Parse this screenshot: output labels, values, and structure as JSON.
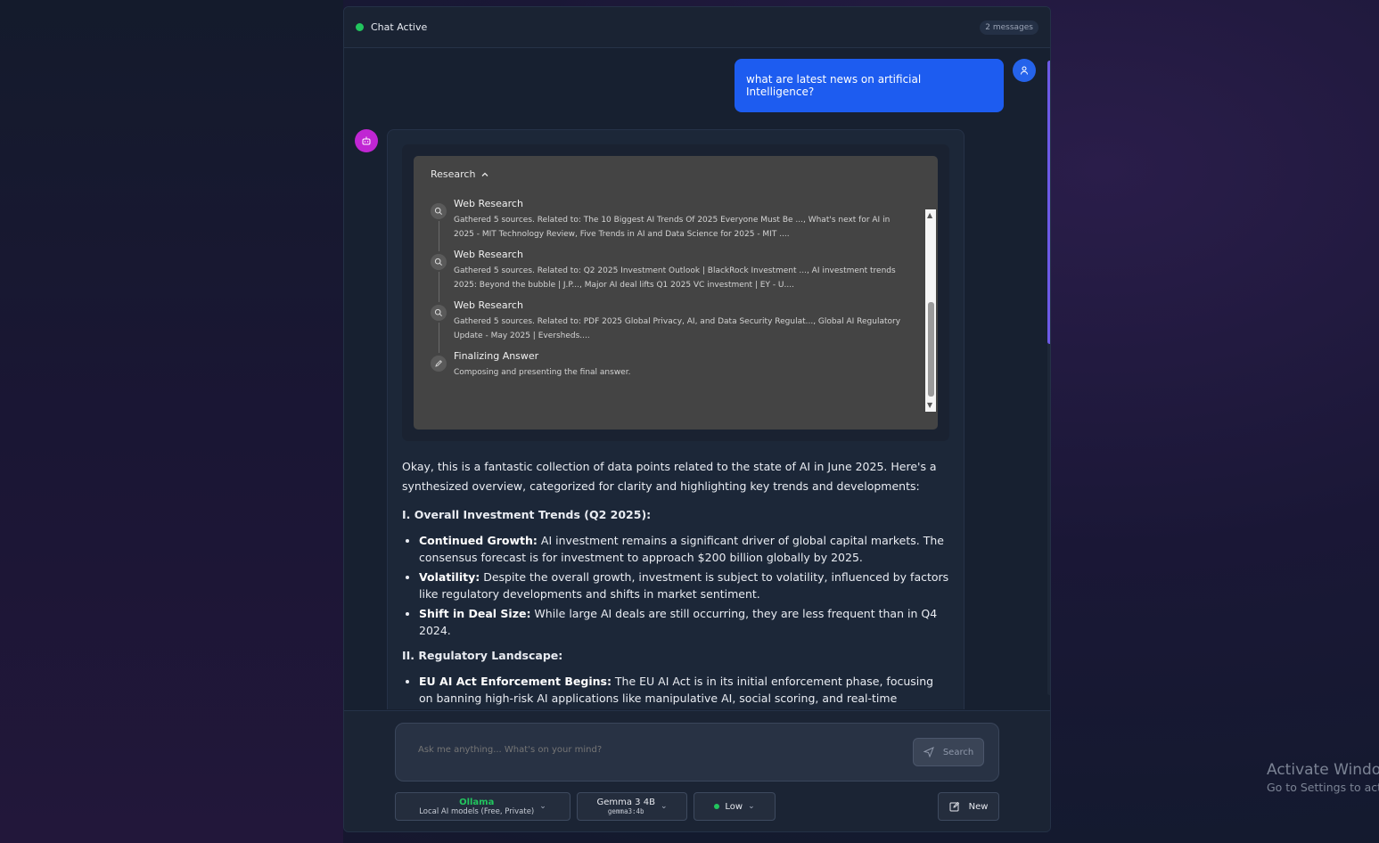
{
  "header": {
    "status": "Chat Active",
    "message_count": "2 messages"
  },
  "user_message": "what are latest news on artificial Intelligence?",
  "research": {
    "title": "Research",
    "steps": [
      {
        "title": "Web Research",
        "desc": "Gathered 5 sources. Related to: The 10 Biggest AI Trends Of 2025 Everyone Must Be ..., What's next for AI in 2025 - MIT Technology Review, Five Trends in AI and Data Science for 2025 - MIT ...."
      },
      {
        "title": "Web Research",
        "desc": "Gathered 5 sources. Related to: Q2 2025 Investment Outlook | BlackRock Investment ..., AI investment trends 2025: Beyond the bubble | J.P..., Major AI deal lifts Q1 2025 VC investment | EY - U...."
      },
      {
        "title": "Web Research",
        "desc": "Gathered 5 sources. Related to: PDF 2025 Global Privacy, AI, and Data Security Regulat..., Global AI Regulatory Update - May 2025 | Eversheds...."
      },
      {
        "title": "Finalizing Answer",
        "desc": "Composing and presenting the final answer."
      }
    ]
  },
  "answer": {
    "intro": "Okay, this is a fantastic collection of data points related to the state of AI in June 2025. Here's a synthesized overview, categorized for clarity and highlighting key trends and developments:",
    "section1_heading": "I. Overall Investment Trends (Q2 2025):",
    "section1_items": [
      {
        "label": "Continued Growth:",
        "text": " AI investment remains a significant driver of global capital markets. The consensus forecast is for investment to approach $200 billion globally by 2025."
      },
      {
        "label": "Volatility:",
        "text": " Despite the overall growth, investment is subject to volatility, influenced by factors like regulatory developments and shifts in market sentiment."
      },
      {
        "label": "Shift in Deal Size:",
        "text": " While large AI deals are still occurring, they are less frequent than in Q4 2024."
      }
    ],
    "section2_heading": "II. Regulatory Landscape:",
    "section2_items": [
      {
        "label": "EU AI Act Enforcement Begins:",
        "text": " The EU AI Act is in its initial enforcement phase, focusing on banning high-risk AI applications like manipulative AI, social scoring, and real-time biometric"
      }
    ]
  },
  "input": {
    "placeholder": "Ask me anything... What's on your mind?",
    "search_label": "Search"
  },
  "controls": {
    "provider_name": "Ollama",
    "provider_sub": "Local AI models (Free, Private)",
    "model_name": "Gemma 3 4B",
    "model_id": "gemma3:4b",
    "effort": "Low",
    "new_label": "New"
  },
  "watermark": {
    "line1": "Activate Windows",
    "line2": "Go to Settings to activate Windows."
  },
  "colors": {
    "accent": "#1d5cf0",
    "status_green": "#22c55e",
    "bot_avatar": "#c026d3",
    "scroll_thumb": "#6d5ae6"
  }
}
